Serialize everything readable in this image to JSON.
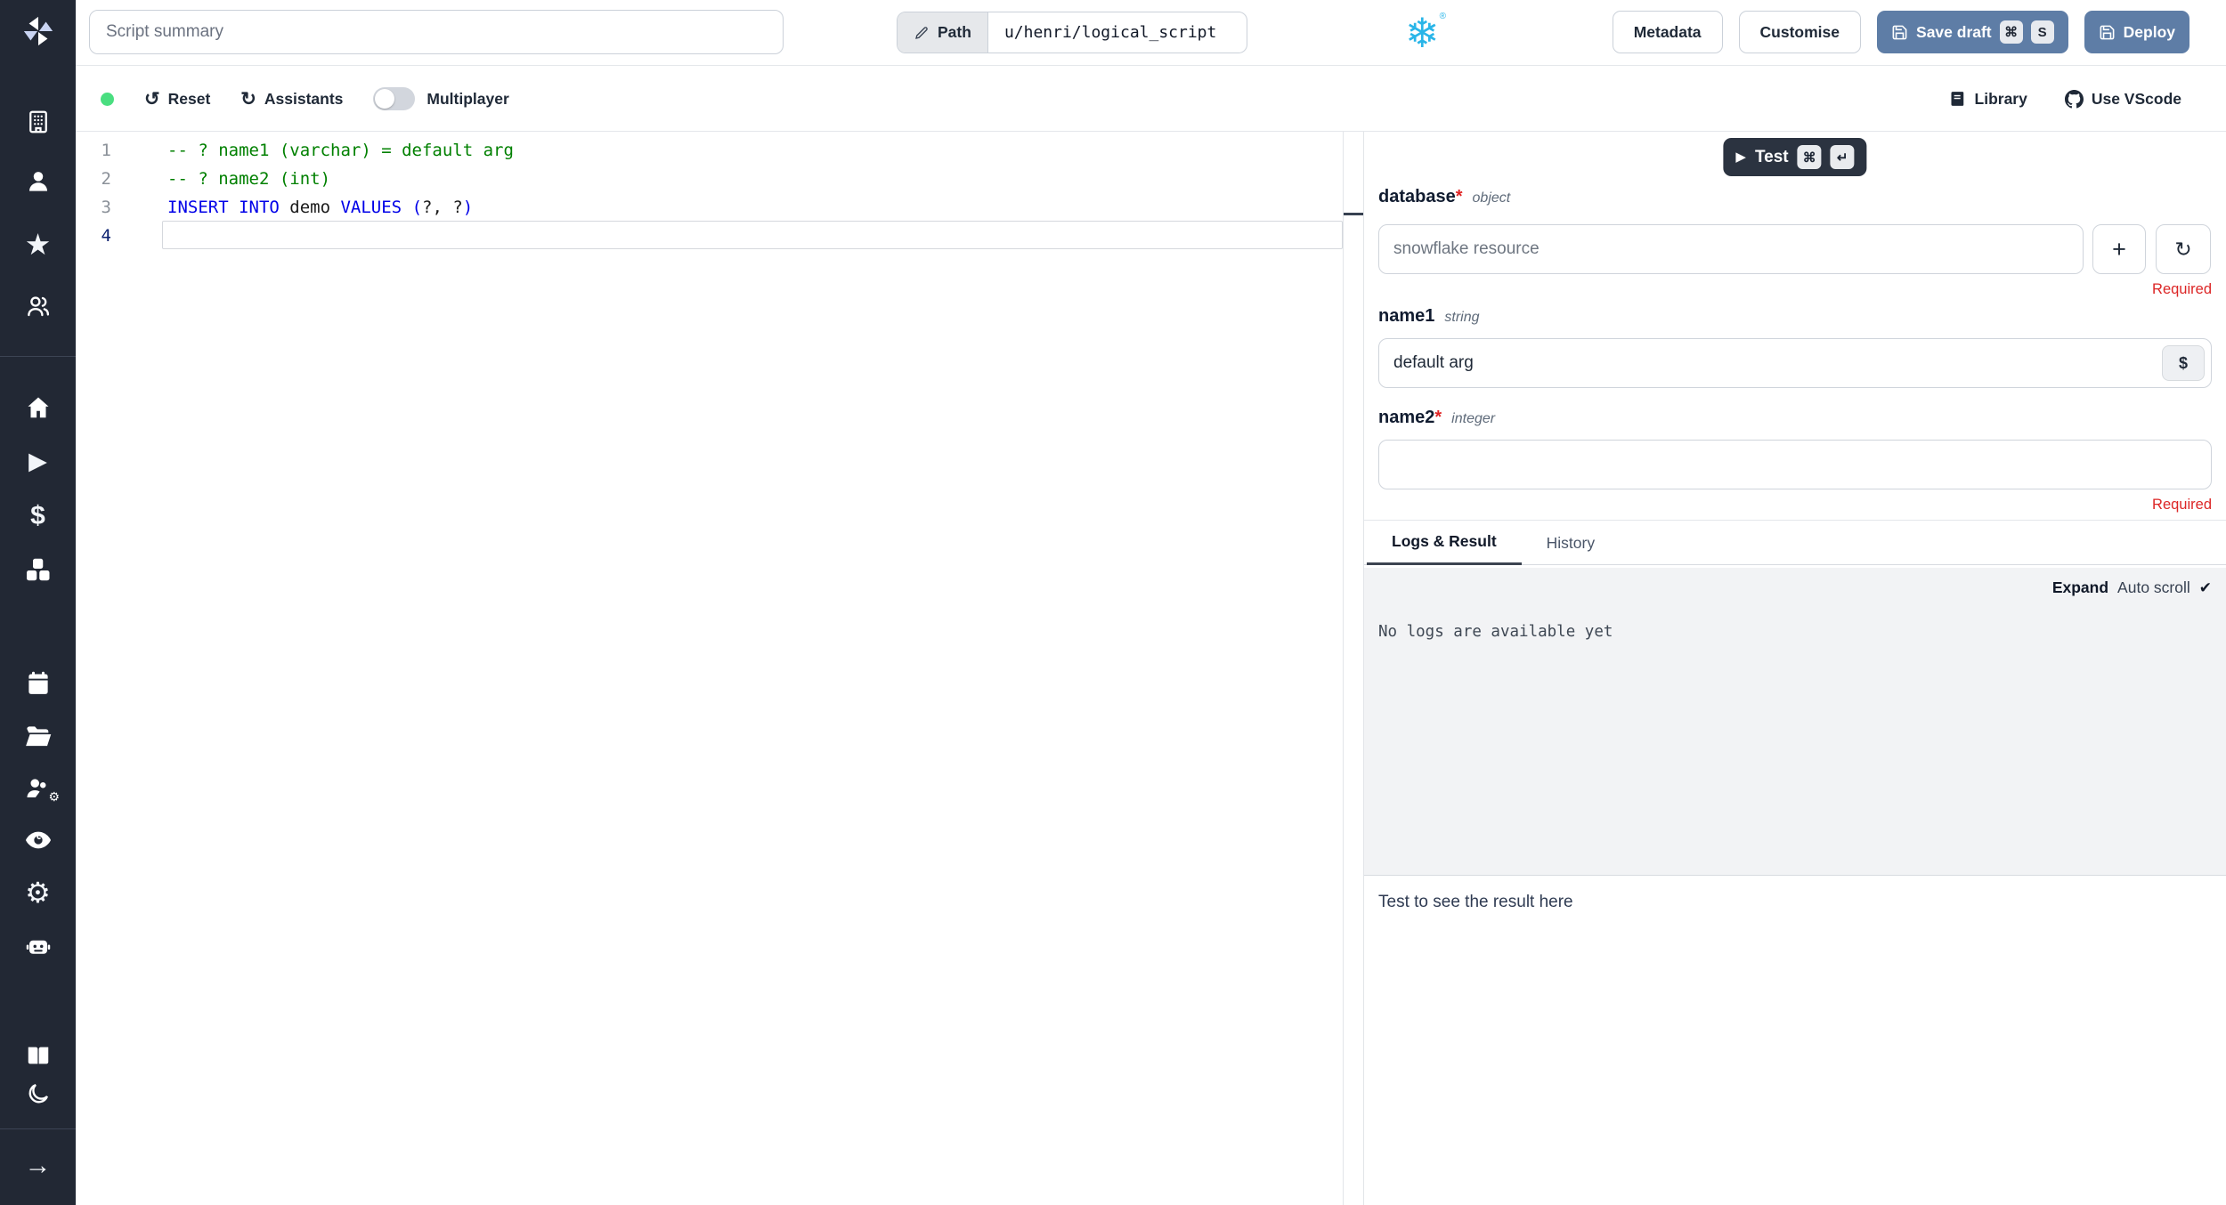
{
  "colors": {
    "sidebar_bg": "#222834",
    "accent_button": "#5e7da6",
    "snowflake_blue": "#29b5e8",
    "status_green": "#4ade80",
    "required_red": "#dc2626",
    "code_keyword": "#0000e8",
    "code_comment": "#008000"
  },
  "sidebar": {
    "icon_names": [
      "windmill-logo",
      "building",
      "person",
      "star",
      "users",
      "home",
      "play",
      "dollar",
      "cubes",
      "calendar",
      "folder-open",
      "user-gear",
      "eye",
      "gear",
      "robot",
      "book-open",
      "moon",
      "arrow-right"
    ],
    "glyphs": {
      "star": "★",
      "play": "▶",
      "dollar": "$",
      "gear": "⚙",
      "arrow": "→",
      "mini_gear": "⚙"
    }
  },
  "topbar": {
    "summary_placeholder": "Script summary",
    "path_label": "Path",
    "path_value": "u/henri/logical_script",
    "language_icon": "❄",
    "reg_mark": "®",
    "metadata_label": "Metadata",
    "customise_label": "Customise",
    "save_draft_label": "Save draft",
    "save_kbd_mod": "⌘",
    "save_kbd_key": "S",
    "deploy_label": "Deploy"
  },
  "toolbar": {
    "reset_icon": "↺",
    "reset_label": "Reset",
    "assistants_icon": "↻",
    "assistants_label": "Assistants",
    "multiplayer_label": "Multiplayer",
    "multiplayer_on": false,
    "library_label": "Library",
    "vscode_label": "Use VScode"
  },
  "editor": {
    "language": "snowflake-sql",
    "lines": [
      {
        "number": "1",
        "tokens": [
          {
            "t": "-- ? name1 (varchar) = default arg",
            "c": "comment"
          }
        ]
      },
      {
        "number": "2",
        "tokens": [
          {
            "t": "-- ? name2 (int)",
            "c": "comment"
          }
        ]
      },
      {
        "number": "3",
        "tokens": [
          {
            "t": "INSERT INTO ",
            "c": "kw"
          },
          {
            "t": "demo ",
            "c": "plain"
          },
          {
            "t": "VALUES ",
            "c": "kw"
          },
          {
            "t": "(",
            "c": "kw"
          },
          {
            "t": "?, ?",
            "c": "plain"
          },
          {
            "t": ")",
            "c": "kw"
          }
        ]
      },
      {
        "number": "4",
        "tokens": []
      }
    ]
  },
  "panel": {
    "play_icon": "▶",
    "test_label": "Test",
    "test_kbd_mod": "⌘",
    "test_kbd_key": "↵",
    "fields": {
      "database": {
        "label": "database",
        "star": "*",
        "type": "object",
        "placeholder": "snowflake resource",
        "required": "Required",
        "plus_icon": "+",
        "refresh_icon": "↻"
      },
      "name1": {
        "label": "name1",
        "type": "string",
        "value": "default arg",
        "dollar": "$"
      },
      "name2": {
        "label": "name2",
        "star": "*",
        "type": "integer",
        "required": "Required"
      }
    },
    "tabs": {
      "logs": "Logs & Result",
      "history": "History"
    },
    "expand_label": "Expand",
    "autoscroll_label": "Auto scroll",
    "check_icon": "✔",
    "logs_empty": "No logs are available yet",
    "result_hint": "Test to see the result here"
  }
}
